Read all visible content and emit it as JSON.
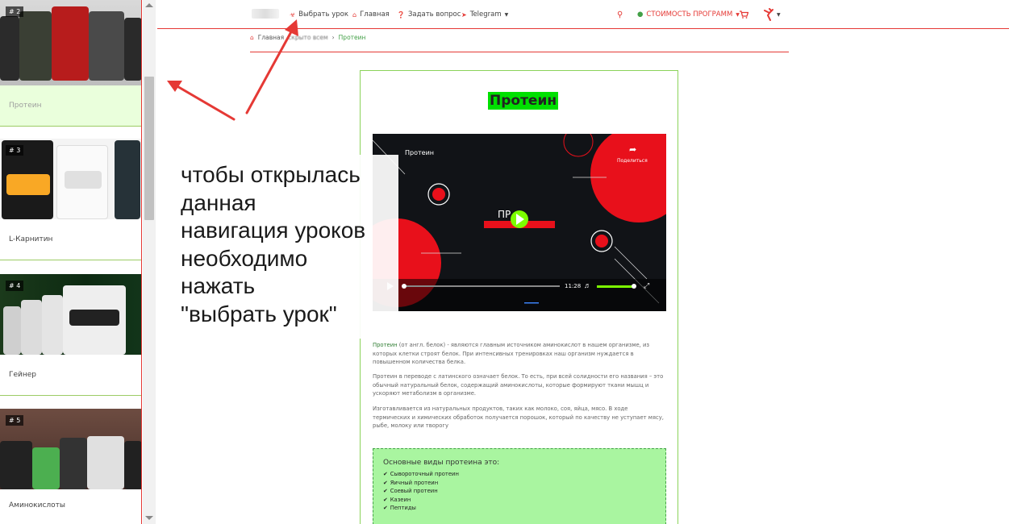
{
  "sidebar": {
    "lessons": [
      {
        "num": "# 2",
        "title": "Протеин",
        "active": true
      },
      {
        "num": "# 3",
        "title": "L-Карнитин",
        "active": false
      },
      {
        "num": "# 4",
        "title": "Гейнер",
        "active": false
      },
      {
        "num": "# 5",
        "title": "Аминокислоты",
        "active": false
      }
    ]
  },
  "nav": {
    "choose_lesson": "Выбрать урок",
    "home": "Главная",
    "ask_question": "Задать вопрос",
    "telegram": "Telegram",
    "price": "СТОИМОСТЬ ПРОГРАММ"
  },
  "breadcrumb": {
    "home": "Главная",
    "hidden": "скрыто всем",
    "current": "Протеин"
  },
  "page_title": "Протеин",
  "video": {
    "title": "Протеин",
    "share": "Поделиться",
    "center_text": "ПР",
    "time": "11:28"
  },
  "article": {
    "p1_highlight": "Протеин",
    "p1_rest": " (от англ. белок) - являются главным источником аминокислот в нашем организме, из которых клетки строят белок. При интенсивных тренировках наш организм нуждается в повышенном количества белка.",
    "p2": "Протеин в переводе с латинского означает белок. То есть, при всей солидности его названия – это обычный натуральный белок, содержащий аминокислоты, которые формируют ткани мышц и ускоряют метаболизм в организме.",
    "p3": "Изготавливается из натуральных продуктов, таких как молоко, соя, яйца, мясо. В ходе термических и химических обработок получается порошок, который по качеству не уступает мясу, рыбе, молоку или творогу"
  },
  "kinds": {
    "heading": "Основные виды протеина это:",
    "items": [
      "Сывороточный протеин",
      "Яичный протеин",
      "Соевый протеин",
      "Казеин",
      "Пептиды"
    ]
  },
  "annotation": {
    "lines": [
      "чтобы открылась",
      "данная",
      "навигация уроков",
      "необходимо",
      "нажать",
      "\"выбрать урок\""
    ]
  },
  "colors": {
    "accent_red": "#e53935",
    "accent_green": "#00e000",
    "card_border": "#8bd35a",
    "kinds_bg": "#a9f5a0"
  }
}
